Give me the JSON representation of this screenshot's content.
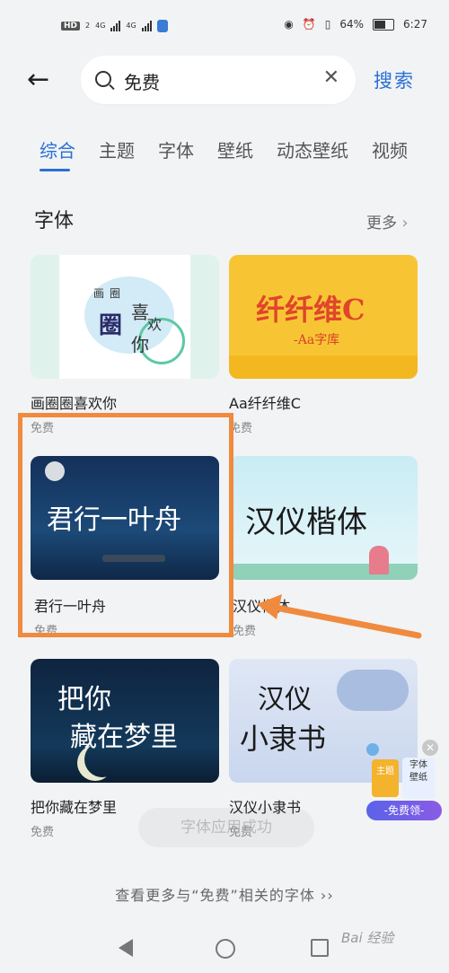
{
  "status_bar": {
    "hd": "HD",
    "hd_sub": "2",
    "net1": "4G",
    "net2": "4G",
    "battery": "64%",
    "time": "6:27"
  },
  "search": {
    "query": "免费",
    "clear": "✕",
    "submit": "搜索"
  },
  "tabs": [
    "综合",
    "主题",
    "字体",
    "壁纸",
    "动态壁纸",
    "视频"
  ],
  "section": {
    "title": "字体",
    "more": "更多",
    "chevron": "›"
  },
  "cards": [
    {
      "name": "画圈圈喜欢你",
      "price": "免费",
      "thumb_lines": [
        "画",
        "圈",
        "圈",
        "喜",
        "欢",
        "你"
      ]
    },
    {
      "name": "Aa纤纤维C",
      "price": "免费",
      "thumb_lines": [
        "纤纤维C",
        "-Aa字库"
      ]
    },
    {
      "name": "君行一叶舟",
      "price": "免费",
      "thumb_lines": [
        "君行一叶舟"
      ]
    },
    {
      "name": "汉仪楷体",
      "price": "免费",
      "thumb_lines": [
        "汉仪楷体"
      ]
    },
    {
      "name": "把你藏在梦里",
      "price": "免费",
      "thumb_lines": [
        "把你",
        "藏在梦里"
      ]
    },
    {
      "name": "汉仪小隶书",
      "price": "免费",
      "thumb_lines": [
        "汉仪",
        "小隶书"
      ]
    }
  ],
  "promo": {
    "label1": "主题",
    "label2": "字体",
    "label3": "壁纸",
    "cta": "-免费领-"
  },
  "toast": "字体应用成功",
  "footer": "查看更多与“免费”相关的字体 ››",
  "watermark": "Bai 经验",
  "colors": {
    "accent": "#2a6fd6",
    "highlight": "#f08a3e",
    "background": "#f1f3f5"
  }
}
